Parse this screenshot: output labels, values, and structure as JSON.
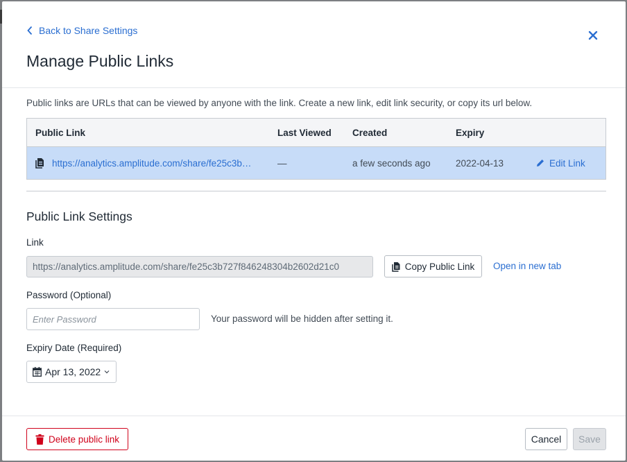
{
  "modal": {
    "back_label": "Back to Share Settings",
    "title": "Manage Public Links",
    "description": "Public links are URLs that can be viewed by anyone with the link. Create a new link, edit link security, or copy its url below."
  },
  "table": {
    "headers": [
      "Public Link",
      "Last Viewed",
      "Created",
      "Expiry",
      ""
    ],
    "rows": [
      {
        "link": "https://analytics.amplitude.com/share/fe25c3b…",
        "last_viewed": "—",
        "created": "a few seconds ago",
        "expiry": "2022-04-13",
        "action": "Edit Link"
      }
    ]
  },
  "settings": {
    "section_title": "Public Link Settings",
    "link_label": "Link",
    "link_value": "https://analytics.amplitude.com/share/fe25c3b727f846248304b2602d21c0",
    "copy_label": "Copy Public Link",
    "open_tab_label": "Open in new tab",
    "password_label": "Password (Optional)",
    "password_placeholder": "Enter Password",
    "password_hint": "Your password will be hidden after setting it.",
    "expiry_label": "Expiry Date (Required)",
    "expiry_value": "Apr 13, 2022"
  },
  "footer": {
    "delete_label": "Delete public link",
    "cancel_label": "Cancel",
    "save_label": "Save"
  },
  "colors": {
    "link": "#2a6ed1",
    "selected_row": "#c7dcf8",
    "danger": "#d0021b"
  }
}
